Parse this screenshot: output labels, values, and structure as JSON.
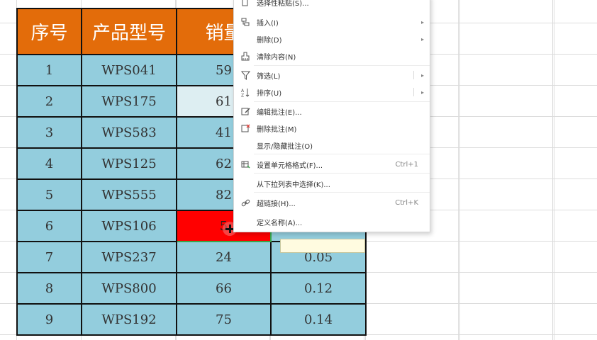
{
  "table": {
    "headers": [
      "序号",
      "产品型号",
      "销量",
      ""
    ],
    "rows": [
      {
        "no": "1",
        "model": "WPS041",
        "sales": "59",
        "ratio": ""
      },
      {
        "no": "2",
        "model": "WPS175",
        "sales": "61",
        "ratio": ""
      },
      {
        "no": "3",
        "model": "WPS583",
        "sales": "41",
        "ratio": ""
      },
      {
        "no": "4",
        "model": "WPS125",
        "sales": "62",
        "ratio": ""
      },
      {
        "no": "5",
        "model": "WPS555",
        "sales": "82",
        "ratio": ""
      },
      {
        "no": "6",
        "model": "WPS106",
        "sales": "5",
        "ratio": ""
      },
      {
        "no": "7",
        "model": "WPS237",
        "sales": "24",
        "ratio": "0.05"
      },
      {
        "no": "8",
        "model": "WPS800",
        "sales": "66",
        "ratio": "0.12"
      },
      {
        "no": "9",
        "model": "WPS192",
        "sales": "75",
        "ratio": "0.14"
      }
    ]
  },
  "context_menu": {
    "items": [
      {
        "label": "选择性粘贴(S)...",
        "shortcut": "",
        "icon": "paste-special-icon"
      },
      {
        "label": "插入(I)",
        "shortcut": "",
        "icon": "insert-icon"
      },
      {
        "label": "删除(D)",
        "shortcut": "",
        "icon": ""
      },
      {
        "label": "清除内容(N)",
        "shortcut": "",
        "icon": "clear-content-icon"
      },
      {
        "label": "筛选(L)",
        "shortcut": "",
        "icon": "filter-icon"
      },
      {
        "label": "排序(U)",
        "shortcut": "",
        "icon": "sort-icon"
      },
      {
        "label": "编辑批注(E)...",
        "shortcut": "",
        "icon": "edit-comment-icon"
      },
      {
        "label": "删除批注(M)",
        "shortcut": "",
        "icon": "delete-comment-icon"
      },
      {
        "label": "显示/隐藏批注(O)",
        "shortcut": "",
        "icon": ""
      },
      {
        "label": "设置单元格格式(F)...",
        "shortcut": "Ctrl+1",
        "icon": "format-cells-icon"
      },
      {
        "label": "从下拉列表中选择(K)...",
        "shortcut": "",
        "icon": ""
      },
      {
        "label": "超链接(H)...",
        "shortcut": "Ctrl+K",
        "icon": "hyperlink-icon"
      },
      {
        "label": "定义名称(A)...",
        "shortcut": "",
        "icon": ""
      }
    ]
  },
  "colors": {
    "header_bg": "#e36c0a",
    "cell_bg": "#93cddd",
    "selected_cell_bg": "#ff0000",
    "selection_border": "#3aa54a"
  }
}
